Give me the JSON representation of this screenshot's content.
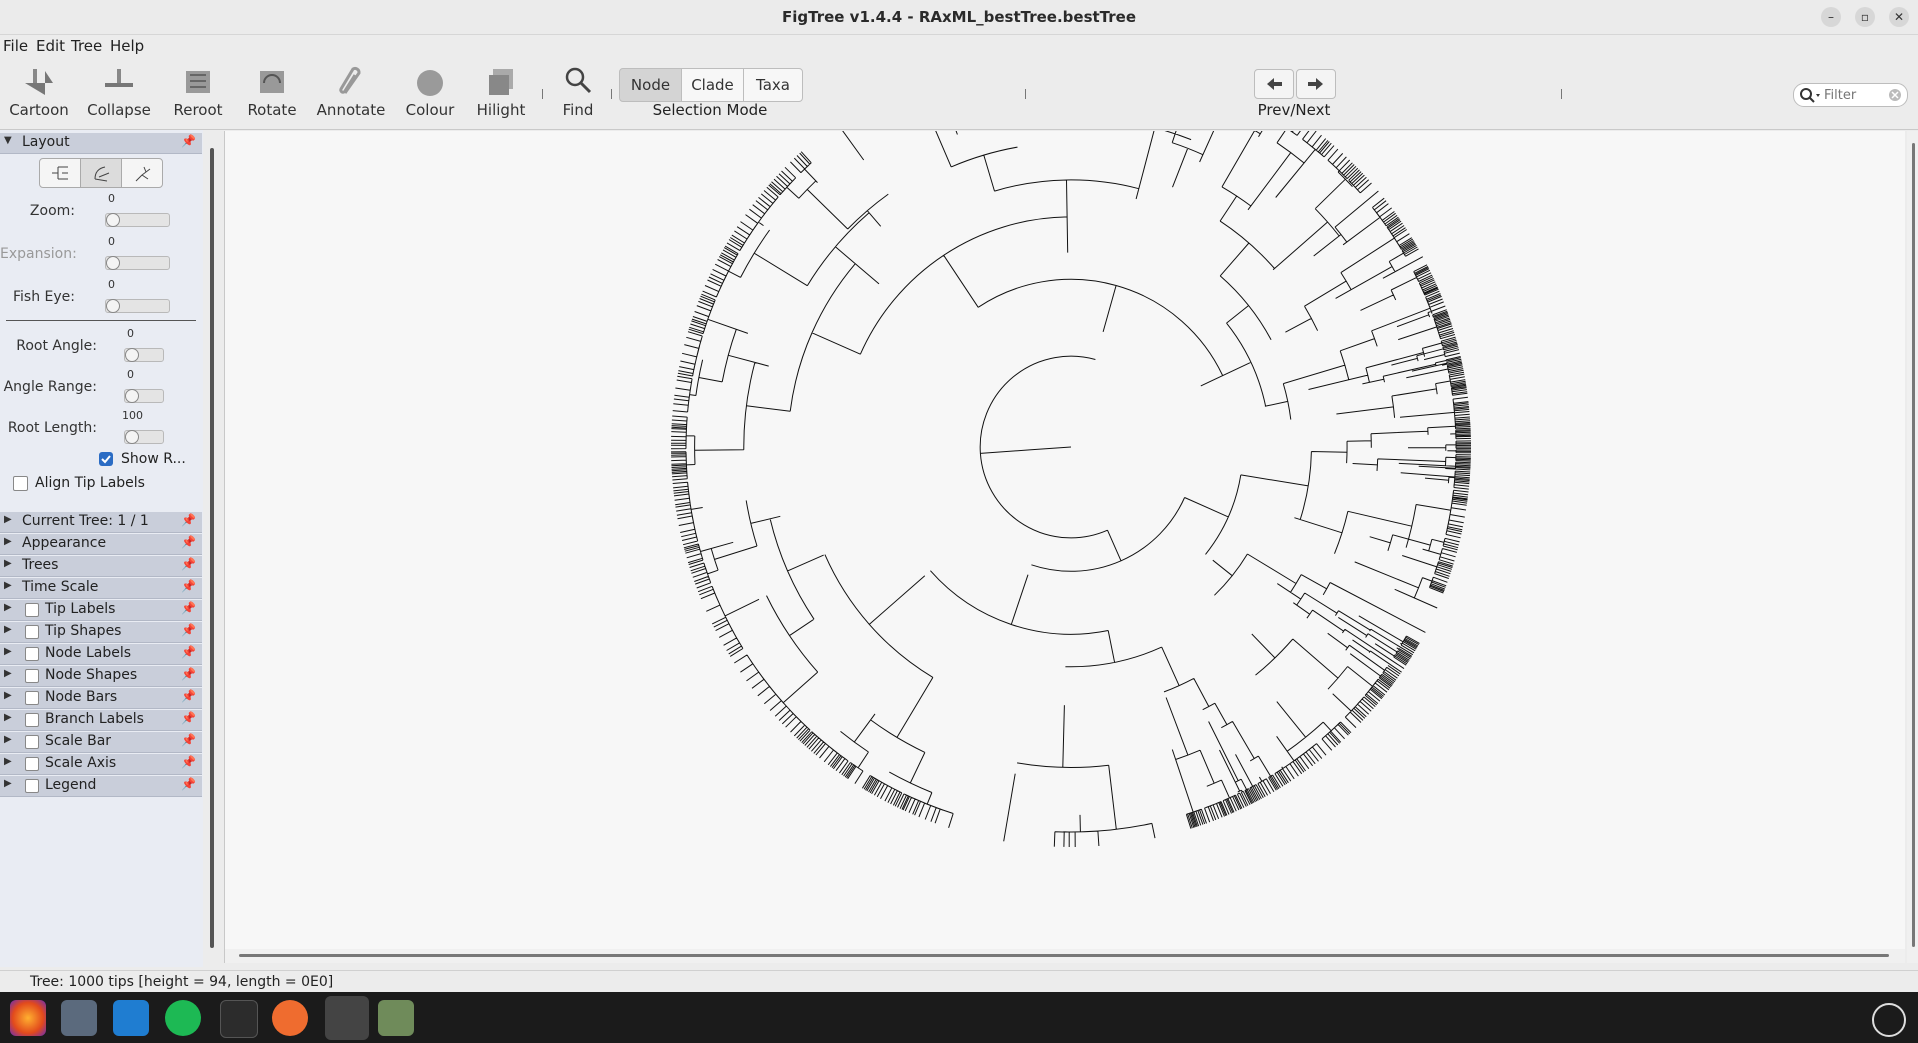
{
  "window": {
    "title": "FigTree v1.4.4 - RAxML_bestTree.bestTree"
  },
  "menu": {
    "items": [
      "File",
      "Edit",
      "Tree",
      "Help"
    ]
  },
  "toolbar": {
    "tools": [
      "Cartoon",
      "Collapse",
      "Reroot",
      "Rotate",
      "Annotate",
      "Colour",
      "Hilight",
      "Find"
    ],
    "selection_modes": [
      "Node",
      "Clade",
      "Taxa"
    ],
    "selected_mode": "Node",
    "selection_mode_label": "Selection Mode",
    "prevnext_label": "Prev/Next",
    "filter_placeholder": "Filter"
  },
  "layout_panel": {
    "title": "Layout",
    "zoom": {
      "label": "Zoom:",
      "value": "0"
    },
    "expansion": {
      "label": "Expansion:",
      "value": "0"
    },
    "fisheye": {
      "label": "Fish Eye:",
      "value": "0"
    },
    "root_angle": {
      "label": "Root Angle:",
      "value": "0"
    },
    "angle_range": {
      "label": "Angle Range:",
      "value": "0"
    },
    "root_length": {
      "label": "Root Length:",
      "value": "100"
    },
    "show_root": {
      "label": "Show R...",
      "checked": true
    },
    "align_tip": {
      "label": "Align Tip Labels",
      "checked": false
    }
  },
  "panels": [
    {
      "label": "Current Tree: 1 / 1",
      "checkbox": false
    },
    {
      "label": "Appearance",
      "checkbox": false
    },
    {
      "label": "Trees",
      "checkbox": false
    },
    {
      "label": "Time Scale",
      "checkbox": false
    },
    {
      "label": "Tip Labels",
      "checkbox": true
    },
    {
      "label": "Tip Shapes",
      "checkbox": true
    },
    {
      "label": "Node Labels",
      "checkbox": true
    },
    {
      "label": "Node Shapes",
      "checkbox": true
    },
    {
      "label": "Node Bars",
      "checkbox": true
    },
    {
      "label": "Branch Labels",
      "checkbox": true
    },
    {
      "label": "Scale Bar",
      "checkbox": true
    },
    {
      "label": "Scale Axis",
      "checkbox": true
    },
    {
      "label": "Legend",
      "checkbox": true
    }
  ],
  "status": {
    "text": "Tree: 1000 tips [height = 94, length = 0E0]"
  },
  "colors": {
    "accent": "#2b6cc4",
    "panel_header": "#c9ceda",
    "taskbar": "#1b1b1b"
  },
  "taskbar": {
    "apps": [
      "firefox-icon",
      "files-icon",
      "vscode-icon",
      "spotify-icon",
      "terminal-icon",
      "postman-icon",
      "settings-icon",
      "trash-icon"
    ]
  }
}
